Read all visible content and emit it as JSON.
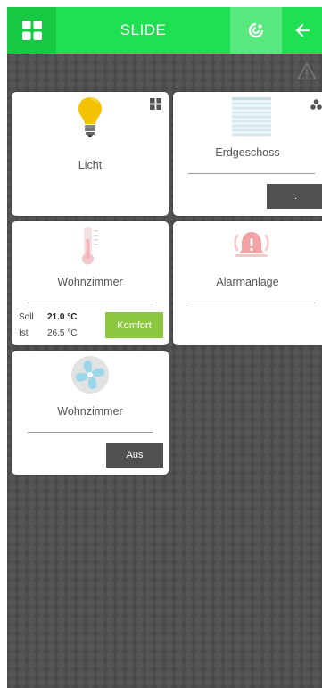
{
  "header": {
    "title": "SLIDE"
  },
  "tiles": {
    "licht": {
      "label": "Licht"
    },
    "erdgeschoss": {
      "label": "Erdgeschoss",
      "button_label": ".."
    },
    "thermostat": {
      "label": "Wohnzimmer",
      "soll_label": "Soll",
      "soll_value": "21.0 °C",
      "ist_label": "Ist",
      "ist_value": "26.5 °C",
      "mode_button": "Komfort"
    },
    "alarm": {
      "label": "Alarmanlage"
    },
    "fan": {
      "label": "Wohnzimmer",
      "button_label": "Aus"
    }
  },
  "colors": {
    "header_bg": "#1fe050",
    "accent_green": "#8dc63f",
    "background": "#4a4a4a"
  }
}
